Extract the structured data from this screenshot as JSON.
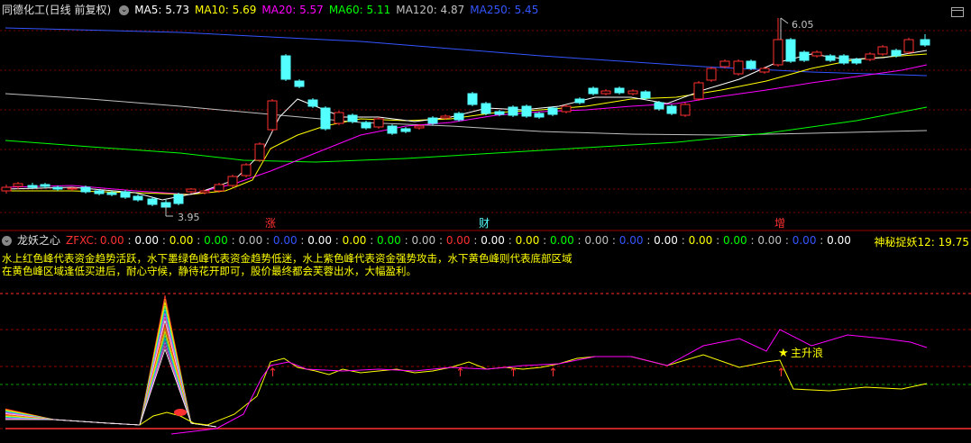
{
  "top_bar": {
    "title": "同德化工(日线 前复权)",
    "ma": [
      {
        "label": "MA5: 5.73",
        "color": "#ffffff"
      },
      {
        "label": "MA10: 5.69",
        "color": "#ffff00"
      },
      {
        "label": "MA20: 5.57",
        "color": "#ff00ff"
      },
      {
        "label": "MA60: 5.11",
        "color": "#00ff00"
      },
      {
        "label": "MA120: 4.87",
        "color": "#c0c0c0"
      },
      {
        "label": "MA250: 5.45",
        "color": "#3355ff"
      }
    ]
  },
  "price_labels": {
    "high": "6.05",
    "low": "3.95"
  },
  "day_markers": [
    "涨",
    "财",
    "增"
  ],
  "sub_bar": {
    "title": "龙妖之心",
    "zfxc_label": "ZFXC:",
    "values": [
      {
        "text": "0.00",
        "color": "#ff3030"
      },
      {
        "text": "0.00",
        "color": "#ffffff"
      },
      {
        "text": "0.00",
        "color": "#ffff00"
      },
      {
        "text": "0.00",
        "color": "#00ff00"
      },
      {
        "text": "0.00",
        "color": "#c0c0c0"
      },
      {
        "text": "0.00",
        "color": "#3355ff"
      },
      {
        "text": "0.00",
        "color": "#ffffff"
      },
      {
        "text": "0.00",
        "color": "#ffff00"
      },
      {
        "text": "0.00",
        "color": "#00ff00"
      },
      {
        "text": "0.00",
        "color": "#c0c0c0"
      },
      {
        "text": "0.00",
        "color": "#ff3030"
      },
      {
        "text": "0.00",
        "color": "#ffffff"
      },
      {
        "text": "0.00",
        "color": "#ffff00"
      },
      {
        "text": "0.00",
        "color": "#00ff00"
      },
      {
        "text": "0.00",
        "color": "#c0c0c0"
      },
      {
        "text": "0.00",
        "color": "#3355ff"
      },
      {
        "text": "0.00",
        "color": "#ffffff"
      },
      {
        "text": "0.00",
        "color": "#ffff00"
      },
      {
        "text": "0.00",
        "color": "#00ff00"
      },
      {
        "text": "0.00",
        "color": "#c0c0c0"
      },
      {
        "text": "0.00",
        "color": "#3355ff"
      },
      {
        "text": "0.00",
        "color": "#ffffff"
      }
    ],
    "right_label": "神秘捉妖12: 19.75"
  },
  "description": {
    "line1": "水上红色峰代表资金趋势活跃，水下墨绿色峰代表资金趋势低迷，水上紫色峰代表资金强势攻击，水下黄色峰则代表底部区域",
    "line2": "在黄色峰区域逢低买进后，耐心守候，静待花开即可，股价最终都会芙蓉出水，大幅盈利。"
  },
  "annotation": {
    "main_wave": "主升浪"
  },
  "colors": {
    "up": "#ff3030",
    "down": "#54ffff",
    "ma5": "#ffffff",
    "ma10": "#ffff00",
    "ma20": "#ff00ff",
    "ma60": "#00ff00",
    "ma120": "#c0c0c0",
    "ma250": "#3355ff"
  }
}
